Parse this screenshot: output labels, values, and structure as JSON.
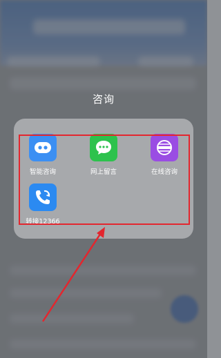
{
  "folder": {
    "title": "咨询",
    "apps": [
      {
        "label": "智能咨询",
        "icon": "robot-chat-icon",
        "color": "#3b8ff3"
      },
      {
        "label": "网上留言",
        "icon": "message-bubble-icon",
        "color": "#2dc24d"
      },
      {
        "label": "在线咨询",
        "icon": "globe-icon",
        "color": "#9a4de3"
      },
      {
        "label": "转接12366",
        "icon": "phone-call-icon",
        "color": "#2b8af1"
      }
    ]
  },
  "annotation": {
    "box_color": "#e3262e",
    "arrow_color": "#e3262e"
  }
}
